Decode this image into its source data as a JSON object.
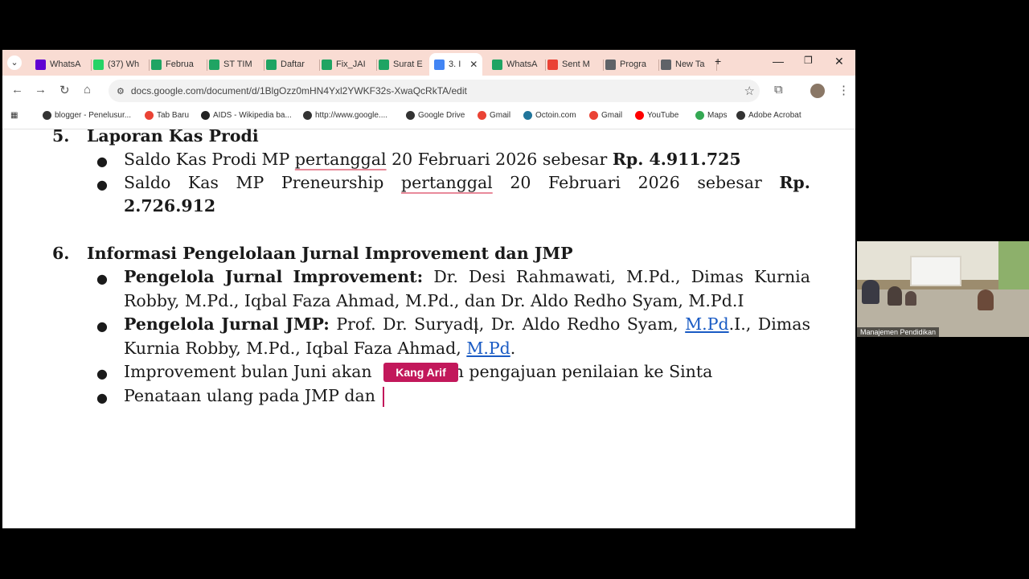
{
  "tabs": [
    {
      "label": "WhatsA",
      "icon": "yahoo-icon",
      "color": "#6001d2"
    },
    {
      "label": "(37) Wh",
      "icon": "whatsapp-icon",
      "color": "#25d366"
    },
    {
      "label": "Februa",
      "icon": "google-drive-icon",
      "color": "#1fa463"
    },
    {
      "label": "ST TIM",
      "icon": "google-drive-icon",
      "color": "#1fa463"
    },
    {
      "label": "Daftar",
      "icon": "google-drive-icon",
      "color": "#1fa463"
    },
    {
      "label": "Fix_JAI",
      "icon": "google-drive-icon",
      "color": "#1fa463"
    },
    {
      "label": "Surat E",
      "icon": "google-drive-icon",
      "color": "#1fa463"
    },
    {
      "label": "3. I",
      "icon": "google-docs-icon",
      "color": "#4285f4",
      "active": true
    },
    {
      "label": "WhatsA",
      "icon": "google-drive-icon",
      "color": "#1fa463"
    },
    {
      "label": "Sent M",
      "icon": "gmail-icon",
      "color": "#ea4335"
    },
    {
      "label": "Progra",
      "icon": "globe-icon",
      "color": "#5f6368"
    },
    {
      "label": "New Ta",
      "icon": "chrome-icon",
      "color": "#5f6368"
    }
  ],
  "url": "docs.google.com/document/d/1BlgOzz0mHN4Yxl2YWKF32s-XwaQcRkTA/edit",
  "bookmarks": [
    {
      "label": "blogger - Penelusur...",
      "icon": "globe-icon"
    },
    {
      "label": "Tab Baru",
      "icon": "google-icon"
    },
    {
      "label": "AIDS - Wikipedia ba...",
      "icon": "wikipedia-icon"
    },
    {
      "label": "http://www.google....",
      "icon": "globe-icon"
    },
    {
      "label": "Google Drive",
      "icon": "globe-icon"
    },
    {
      "label": "Gmail",
      "icon": "gmail-icon"
    },
    {
      "label": "Octoin.com",
      "icon": "wordpress-icon"
    },
    {
      "label": "Gmail",
      "icon": "gmail-icon"
    },
    {
      "label": "YouTube",
      "icon": "youtube-icon"
    },
    {
      "label": "Maps",
      "icon": "maps-icon"
    },
    {
      "label": "Adobe Acrobat",
      "icon": "globe-icon"
    }
  ],
  "doc": {
    "s5": {
      "num": "5.",
      "title": "Laporan Kas Prodi"
    },
    "s5b1": {
      "a": "Saldo Kas Prodi MP",
      "b": "pertanggal",
      "c": "20 Februari 2026 sebesar",
      "d": "Rp. 4.911.725"
    },
    "s5b2": {
      "w1": "Saldo",
      "w2": "Kas",
      "w3": "MP",
      "w4": "Preneurship",
      "w5": "pertanggal",
      "w6": "20",
      "w7": "Februari",
      "w8": "2026",
      "w9": "sebesar",
      "w10": "Rp.",
      "cont": "2.726.912"
    },
    "s6": {
      "num": "6.",
      "title": "Informasi Pengelolaan Jurnal Improvement dan JMP"
    },
    "s6b1": {
      "w1": "Pengelola",
      "w2": "Jurnal",
      "w3": "Improvement:",
      "w4": "Dr.",
      "w5": "Desi",
      "w6": "Rahmawati,",
      "w7": "M.Pd.,",
      "w8": "Dimas",
      "w9": "Kurnia",
      "cont": "Robby, M.Pd., Iqbal Faza Ahmad, M.Pd., dan Dr. Aldo Redho Syam, M.Pd.I"
    },
    "s6b2": {
      "w1": "Pengelola",
      "w2": "Jurnal",
      "w3": "JMP:",
      "w4": "Prof.",
      "w5": "Dr.",
      "w6": "Suryadi,",
      "w7": "Dr.",
      "w8": "Aldo",
      "w9": "Redho",
      "w10": "Syam,",
      "link1": "M.Pd",
      "w11": ".I.,",
      "w12": "Dimas",
      "cont": "Kurnia Robby, M.Pd., Iqbal Faza Ahmad,",
      "link2": "M.Pd",
      "end": "."
    },
    "s6b3": {
      "a": "Improvement bulan Juni akan",
      "b": "n pengajuan penilaian ke Sinta"
    },
    "s6b4": {
      "a": "Penataan ulang pada JMP dan"
    }
  },
  "cursor_label": "Kang Arif",
  "video_label": "Manajemen Pendidikan"
}
